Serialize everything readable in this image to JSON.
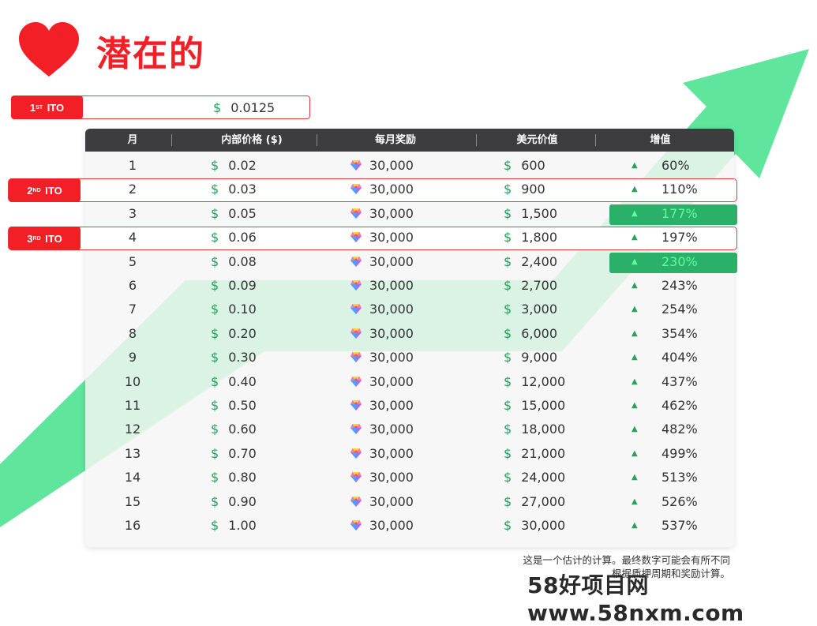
{
  "header": {
    "title": "潜在的"
  },
  "ito_labels": {
    "first": {
      "ordinal": "1",
      "suffix": "ST",
      "label": "ITO"
    },
    "second": {
      "ordinal": "2",
      "suffix": "ND",
      "label": "ITO"
    },
    "third": {
      "ordinal": "3",
      "suffix": "RD",
      "label": "ITO"
    }
  },
  "first_ito_price": "0.0125",
  "table": {
    "headers": {
      "month": "月",
      "price": "内部价格 ($)",
      "reward": "每月奖励",
      "usd": "美元价值",
      "growth": "增值"
    },
    "rows": [
      {
        "month": "1",
        "price": "0.02",
        "reward": "30,000",
        "usd": "600",
        "pct": "60%"
      },
      {
        "month": "2",
        "price": "0.03",
        "reward": "30,000",
        "usd": "900",
        "pct": "110%"
      },
      {
        "month": "3",
        "price": "0.05",
        "reward": "30,000",
        "usd": "1,500",
        "pct": "177%"
      },
      {
        "month": "4",
        "price": "0.06",
        "reward": "30,000",
        "usd": "1,800",
        "pct": "197%"
      },
      {
        "month": "5",
        "price": "0.08",
        "reward": "30,000",
        "usd": "2,400",
        "pct": "230%"
      },
      {
        "month": "6",
        "price": "0.09",
        "reward": "30,000",
        "usd": "2,700",
        "pct": "243%"
      },
      {
        "month": "7",
        "price": "0.10",
        "reward": "30,000",
        "usd": "3,000",
        "pct": "254%"
      },
      {
        "month": "8",
        "price": "0.20",
        "reward": "30,000",
        "usd": "6,000",
        "pct": "354%"
      },
      {
        "month": "9",
        "price": "0.30",
        "reward": "30,000",
        "usd": "9,000",
        "pct": "404%"
      },
      {
        "month": "10",
        "price": "0.40",
        "reward": "30,000",
        "usd": "12,000",
        "pct": "437%"
      },
      {
        "month": "11",
        "price": "0.50",
        "reward": "30,000",
        "usd": "15,000",
        "pct": "462%"
      },
      {
        "month": "12",
        "price": "0.60",
        "reward": "30,000",
        "usd": "18,000",
        "pct": "482%"
      },
      {
        "month": "13",
        "price": "0.70",
        "reward": "30,000",
        "usd": "21,000",
        "pct": "499%"
      },
      {
        "month": "14",
        "price": "0.80",
        "reward": "30,000",
        "usd": "24,000",
        "pct": "513%"
      },
      {
        "month": "15",
        "price": "0.90",
        "reward": "30,000",
        "usd": "27,000",
        "pct": "526%"
      },
      {
        "month": "16",
        "price": "1.00",
        "reward": "30,000",
        "usd": "30,000",
        "pct": "537%"
      }
    ]
  },
  "symbols": {
    "dollar": "$",
    "up": "▲"
  },
  "footnote": {
    "line1": "这是一个估计的计算。最终数字可能会有所不同",
    "line2": "根据质押周期和奖励计算。"
  },
  "watermark": "58好项目网www.58nxm.com",
  "colors": {
    "brand_red": "#f21f26",
    "arrow_green": "#56e597",
    "highlight_green": "#2bb06a",
    "header_dark": "#3d3d3f"
  }
}
